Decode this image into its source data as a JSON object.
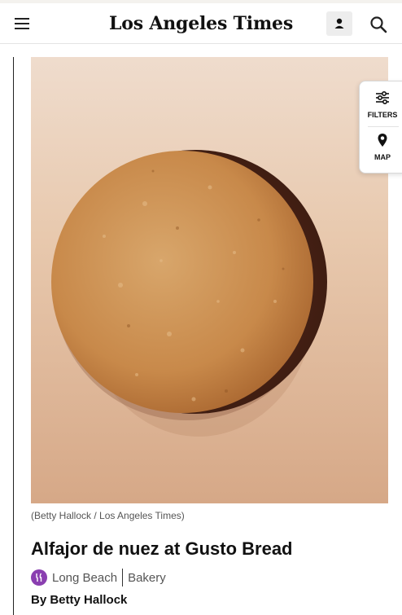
{
  "header": {
    "logo": "Los Angeles Times",
    "icons": {
      "menu": "hamburger-menu-icon",
      "account": "user-icon",
      "search": "search-icon"
    }
  },
  "side_panel": {
    "filters_label": "FILTERS",
    "map_label": "MAP",
    "icons": {
      "filters": "sliders-icon",
      "map": "map-pin-icon"
    }
  },
  "article": {
    "photo_credit": "(Betty Hallock / Los Angeles Times)",
    "title": "Alfajor de nuez at Gusto Bread",
    "neighborhood": "Long Beach",
    "category": "Bakery",
    "byline": "By Betty Hallock",
    "category_icon": "fork-knife-icon"
  },
  "colors": {
    "category_badge": "#8a3fb0",
    "cookie": "#c8894a",
    "chocolate": "#4a2416"
  }
}
